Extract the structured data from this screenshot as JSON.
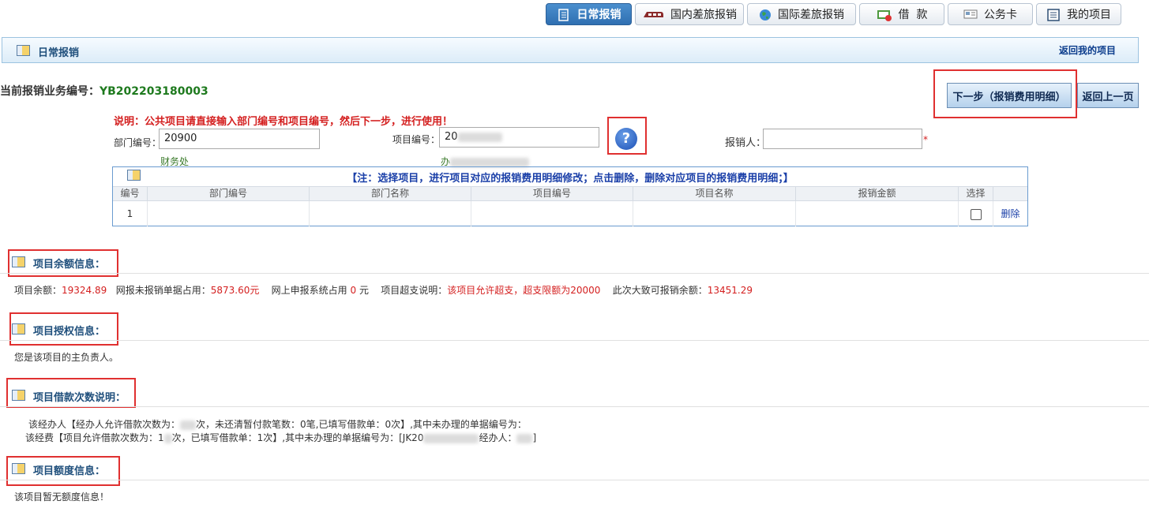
{
  "tabs": [
    {
      "label": "日常报销",
      "icon": "notebook-icon",
      "active": true
    },
    {
      "label": "国内差旅报销",
      "icon": "train-icon",
      "active": false
    },
    {
      "label": "国际差旅报销",
      "icon": "globe-icon",
      "active": false
    },
    {
      "label": "借  款",
      "icon": "loan-icon",
      "active": false
    },
    {
      "label": "公务卡",
      "icon": "card-icon",
      "active": false
    },
    {
      "label": "我的项目",
      "icon": "list-icon",
      "active": false
    }
  ],
  "titlebar": {
    "title": "日常报销",
    "back_link": "返回我的项目"
  },
  "business": {
    "label": "当前报销业务编号：",
    "number": "YB202203180003"
  },
  "buttons": {
    "next": "下一步（报销费用明细）",
    "back": "返回上一页"
  },
  "instruction": "说明：公共项目请直接输入部门编号和项目编号，然后下一步，进行使用！",
  "form": {
    "dept_label": "部门编号：",
    "dept_value": "20900",
    "dept_name": "财务处",
    "project_label": "项目编号：",
    "project_value": "20",
    "project_name": "办",
    "reimburser_label": "报销人：",
    "required_mark": "*"
  },
  "project_table": {
    "note": "【注：选择项目，进行项目对应的报销费用明细修改；点击删除，删除对应项目的报销费用明细；】",
    "headers": [
      "编号",
      "部门编号",
      "部门名称",
      "项目编号",
      "项目名称",
      "报销金额",
      "选择"
    ],
    "rows": [
      {
        "no": "1",
        "delete": "删除"
      }
    ]
  },
  "balance": {
    "title": "项目余额信息：",
    "l1": "项目余额：",
    "v1": "19324.89",
    "l2": "网报未报销单据占用：",
    "v2": "5873.60元",
    "l3": "网上申报系统占用",
    "v3": "0",
    "u3": "元",
    "l4": "项目超支说明：",
    "v4": "该项目允许超支，超支限额为20000",
    "l5": "此次大致可报销余额：",
    "v5": "13451.29"
  },
  "authorization": {
    "title": "项目授权信息：",
    "text": "您是该项目的主负责人。"
  },
  "loan": {
    "title": "项目借款次数说明：",
    "line1a": "该经办人【经办人允许借款次数为：",
    "line1b": "次，未还清暂付款笔数：0笔,已填写借款单：0次】,其中未办理的单据编号为：",
    "line2a": "该经费【项目允许借款次数为：1",
    "line2b": "次，已填写借款单：1次】,其中未办理的单据编号为：[JK20",
    "line2c": "经办人：",
    "line2d": "]"
  },
  "quota": {
    "title": "项目额度信息：",
    "text": "该项目暂无额度信息！"
  }
}
